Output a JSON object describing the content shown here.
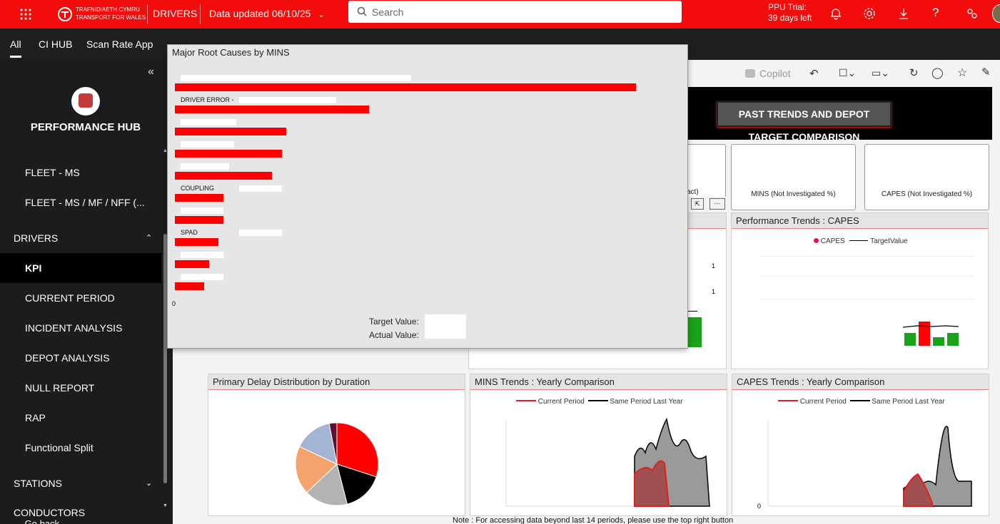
{
  "topbar": {
    "brand_line1": "TRAFNIDIAETH CYMRU",
    "brand_line2": "TRANSPORT FOR WALES",
    "workspace": "DRIVERS",
    "data_updated": "Data updated 06/10/25",
    "search_placeholder": "Search",
    "trial_line1": "PPU Trial:",
    "trial_line2": "39 days left"
  },
  "nav": {
    "tabs": [
      "All",
      "CI HUB",
      "Scan Rate App"
    ]
  },
  "sidebar": {
    "title": "PERFORMANCE HUB",
    "items": [
      {
        "label": "FLEET - MS"
      },
      {
        "label": "FLEET - MS / MF / NFF (..."
      },
      {
        "label": "DRIVERS"
      },
      {
        "label": "KPI"
      },
      {
        "label": "CURRENT PERIOD"
      },
      {
        "label": "INCIDENT ANALYSIS"
      },
      {
        "label": "DEPOT ANALYSIS"
      },
      {
        "label": "NULL REPORT"
      },
      {
        "label": "RAP"
      },
      {
        "label": "Functional Split"
      },
      {
        "label": "STATIONS"
      },
      {
        "label": "CONDUCTORS"
      }
    ],
    "footer": "Go back"
  },
  "toolbar": {
    "copilot": "Copilot"
  },
  "report": {
    "past_trends_button": "PAST TRENDS AND DEPOT TARGET COMPARISON",
    "card_act_fragment": "act)",
    "card_mins": "MINS (Not Investigated %)",
    "card_capes": "CAPES (Not Investigated %)",
    "perf_capes_title": "Performance Trends : CAPES",
    "capes_legend": "CAPES",
    "target_legend": "TargetValue",
    "primary_delay_title": "Primary Delay Distribution by Duration",
    "mins_yearly_title": "MINS Trends : Yearly Comparison",
    "capes_yearly_title": "CAPES Trends : Yearly Comparison",
    "current_period": "Current Period",
    "same_period": "Same Period Last Year",
    "note": "Note : For accessing data beyond last 14 periods, please use the top right button",
    "axis_1a": "1",
    "axis_1b": "1",
    "axis_0a": "0",
    "axis_0b": "0",
    "axis_0c": "0"
  },
  "popup": {
    "title": "Major Root Causes by MINS",
    "bars": [
      {
        "label": "",
        "value": 0.95
      },
      {
        "label": "DRIVER ERROR -",
        "value": 0.4
      },
      {
        "label": "",
        "value": 0.23
      },
      {
        "label": "",
        "value": 0.22
      },
      {
        "label": "",
        "value": 0.2
      },
      {
        "label": "COUPLING",
        "value": 0.1
      },
      {
        "label": "",
        "value": 0.1
      },
      {
        "label": "SPAD",
        "value": 0.09
      },
      {
        "label": "",
        "value": 0.07
      },
      {
        "label": "",
        "value": 0.06
      }
    ],
    "target_label": "Target Value:",
    "actual_label": "Actual Value:",
    "axis_zero": "0"
  },
  "pie": {
    "slices": [
      {
        "value": 30,
        "color": "#ff0000"
      },
      {
        "value": 16,
        "color": "#000000"
      },
      {
        "value": 17,
        "color": "#b3b3b3"
      },
      {
        "value": 19,
        "color": "#f4a36c"
      },
      {
        "value": 15,
        "color": "#a4b4d4"
      },
      {
        "value": 3,
        "color": "#5b1230"
      }
    ]
  },
  "colors": {
    "brand_red": "#f20c0c",
    "bar_red": "#ff0000",
    "green": "#1aa21a",
    "sidebar": "#1c1c1c"
  }
}
